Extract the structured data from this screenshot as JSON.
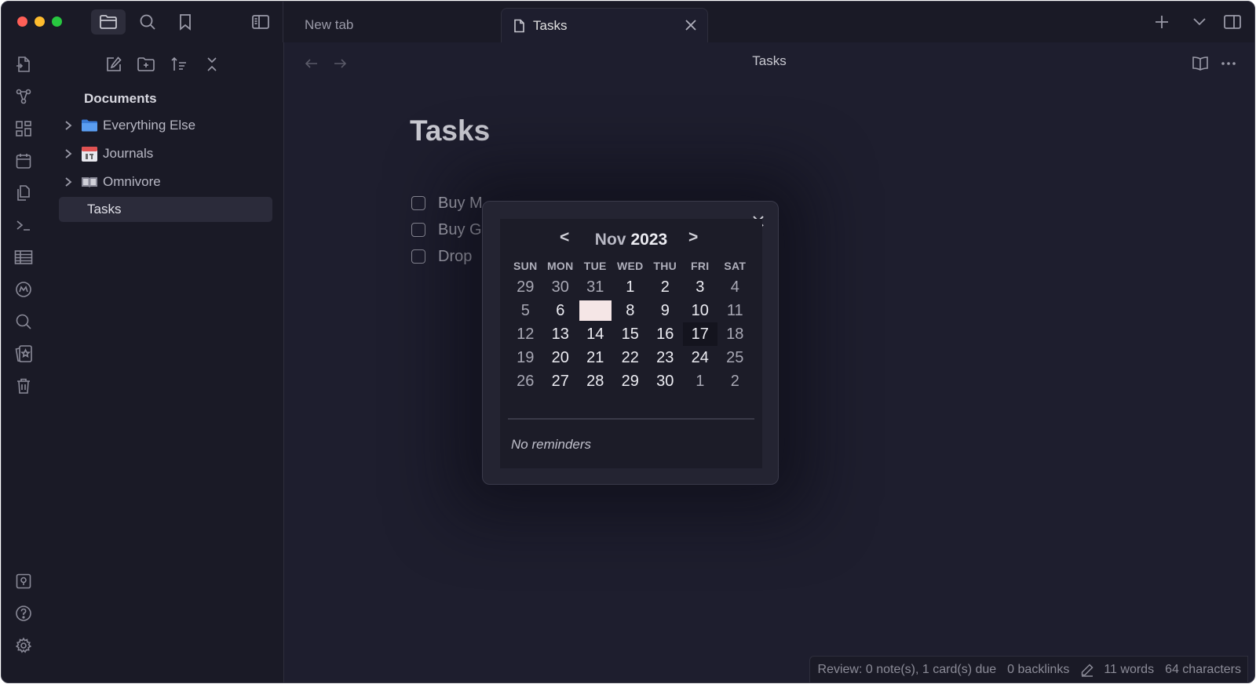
{
  "tabs": {
    "new_tab": "New tab",
    "active_tab": "Tasks"
  },
  "sidebar": {
    "root": "Documents",
    "items": [
      {
        "label": "Everything Else",
        "icon": "folder-icon"
      },
      {
        "label": "Journals",
        "icon": "calendar-emoji-icon"
      },
      {
        "label": "Omnivore",
        "icon": "book-emoji-icon"
      },
      {
        "label": "Tasks",
        "selected": true
      }
    ]
  },
  "main": {
    "header_title": "Tasks",
    "page_title": "Tasks",
    "tasks": [
      "Buy M",
      "Buy G",
      "Drop"
    ]
  },
  "calendar": {
    "prev": "<",
    "next": ">",
    "month": "Nov",
    "year": "2023",
    "weekdays": [
      "SUN",
      "MON",
      "TUE",
      "WED",
      "THU",
      "FRI",
      "SAT"
    ],
    "weeks": [
      [
        "29",
        "30",
        "31",
        "1",
        "2",
        "3",
        "4"
      ],
      [
        "5",
        "6",
        "7",
        "8",
        "9",
        "10",
        "11"
      ],
      [
        "12",
        "13",
        "14",
        "15",
        "16",
        "17",
        "18"
      ],
      [
        "19",
        "20",
        "21",
        "22",
        "23",
        "24",
        "25"
      ],
      [
        "26",
        "27",
        "28",
        "29",
        "30",
        "1",
        "2"
      ]
    ],
    "today": "7",
    "highlighted": "17",
    "note": "No reminders"
  },
  "statusbar": {
    "review": "Review: 0 note(s), 1 card(s) due",
    "backlinks": "0 backlinks",
    "words": "11 words",
    "characters": "64 characters"
  },
  "colors": {
    "background": "#1e1e2e",
    "sidebar": "#1a1a26",
    "today_highlight": "#f5e6e6"
  }
}
